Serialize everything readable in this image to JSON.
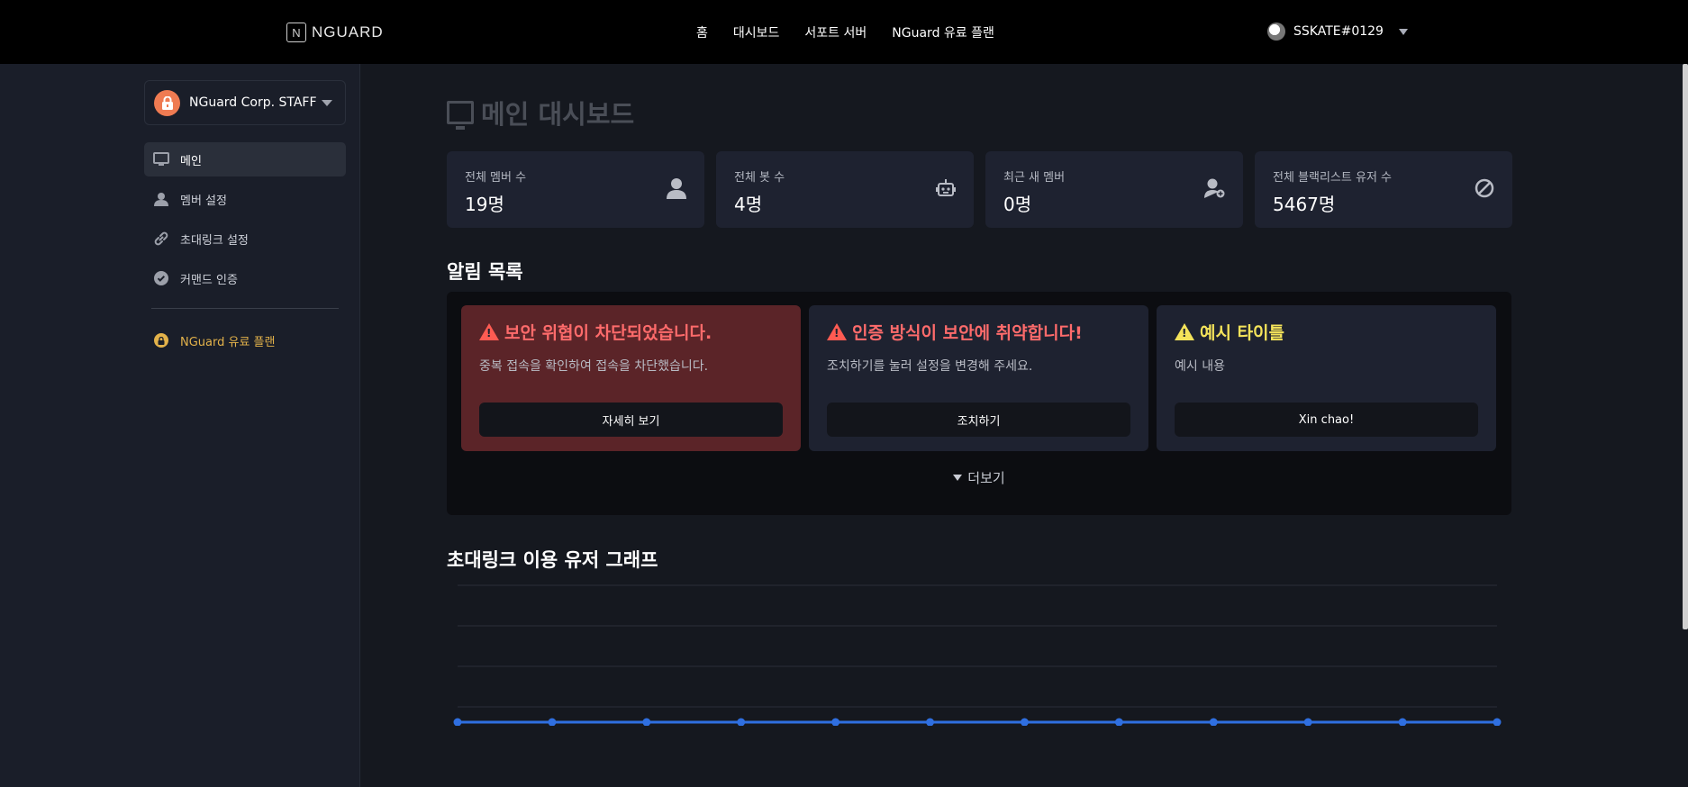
{
  "topnav": {
    "logo_mark": "N",
    "logo_text": "NGUARD",
    "links": [
      "홈",
      "대시보드",
      "서포트 서버",
      "NGuard 유료 플랜"
    ],
    "user_name": "SSKATE#0129"
  },
  "sidebar": {
    "server_name": "NGuard Corp. STAFF",
    "items": [
      {
        "label": "메인",
        "icon": "monitor-icon"
      },
      {
        "label": "멤버 설정",
        "icon": "user-icon"
      },
      {
        "label": "초대링크 설정",
        "icon": "link-icon"
      },
      {
        "label": "커맨드 인증",
        "icon": "check-circle-icon"
      }
    ],
    "premium_label": "NGuard 유료 플랜"
  },
  "main": {
    "title": "메인 대시보드",
    "stats": [
      {
        "label": "전체 멤버 수",
        "value": "19명",
        "icon": "user-icon"
      },
      {
        "label": "전체 봇 수",
        "value": "4명",
        "icon": "robot-icon"
      },
      {
        "label": "최근 새 멤버",
        "value": "0명",
        "icon": "user-add-icon"
      },
      {
        "label": "전체 블랙리스트 유저 수",
        "value": "5467명",
        "icon": "ban-icon"
      }
    ],
    "alerts_title": "알림 목록",
    "alerts": [
      {
        "title": "보안 위협이 차단되었습니다.",
        "body": "중복 접속을 확인하여 접속을 차단했습니다.",
        "button": "자세히 보기",
        "level": "danger"
      },
      {
        "title": "인증 방식이 보안에 취약합니다!",
        "body": "조치하기를 눌러 설정을 변경해 주세요.",
        "button": "조치하기",
        "level": "danger-text"
      },
      {
        "title": "예시 타이틀",
        "body": "예시 내용",
        "button": "Xin chao!",
        "level": "warning"
      }
    ],
    "more_label": "더보기",
    "chart_title": "초대링크 이용 유저 그래프"
  },
  "colors": {
    "accent_blue": "#2f6fe0",
    "danger": "#ff6b6b",
    "warning": "#f4e35a",
    "premium": "#e3b24a"
  },
  "chart_data": {
    "type": "line",
    "points": 12,
    "values": [
      0,
      0,
      0,
      0,
      0,
      0,
      0,
      0,
      0,
      0,
      0,
      0
    ],
    "grid": true
  }
}
